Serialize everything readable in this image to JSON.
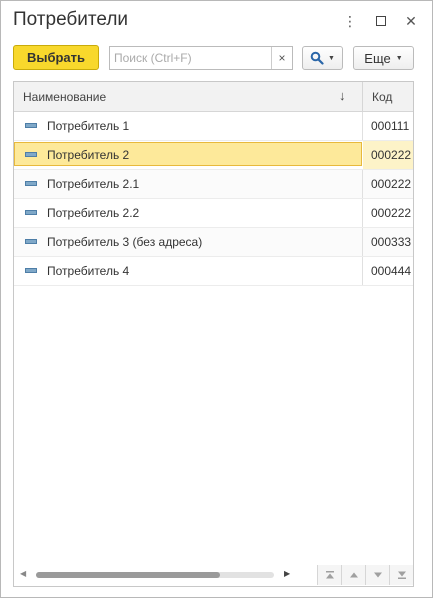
{
  "window": {
    "title": "Потребители",
    "more_glyph": "⋮",
    "close_glyph": "✕"
  },
  "toolbar": {
    "select_label": "Выбрать",
    "search": {
      "placeholder": "Поиск (Ctrl+F)",
      "value": "",
      "clear_glyph": "×"
    },
    "find_icon": "search-icon",
    "more_label": "Еще"
  },
  "table": {
    "columns": {
      "name": "Наименование",
      "code": "Код",
      "sort_glyph": "↓"
    },
    "rows": [
      {
        "name": "Потребитель 1",
        "code": "000111"
      },
      {
        "name": "Потребитель 2",
        "code": "000222"
      },
      {
        "name": "Потребитель 2.1",
        "code": "000222"
      },
      {
        "name": "Потребитель 2.2",
        "code": "000222"
      },
      {
        "name": "Потребитель 3 (без адреса)",
        "code": "000333"
      },
      {
        "name": "Потребитель 4",
        "code": "000444"
      }
    ],
    "selected_row": 1
  },
  "footer": {
    "scroll_left_glyph": "◀",
    "scroll_right_glyph": "▶",
    "nav_buttons": [
      "first-page-icon",
      "prev-page-icon",
      "next-page-icon",
      "last-page-icon"
    ]
  },
  "colors": {
    "accent_button": "#f8d82c",
    "selection_fill": "#fde99a",
    "selection_border": "#e8b93c",
    "item_icon": "#7fa8c8"
  }
}
